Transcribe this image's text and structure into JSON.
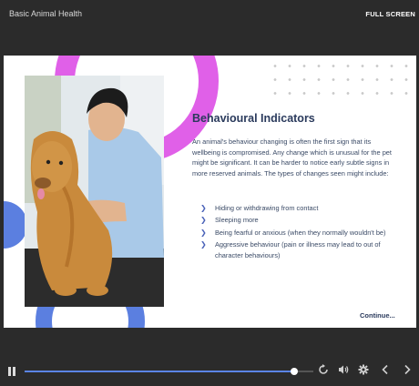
{
  "app": {
    "title": "Basic Animal Health",
    "fullscreen_label": "FULL SCREEN"
  },
  "slide": {
    "heading": "Behavioural Indicators",
    "body": "An animal's behaviour changing is often the first sign that its wellbeing is compromised.  Any change which is unusual for the pet might be significant. It can be harder to notice early subtle signs in more reserved animals. The types of changes seen might include:",
    "bullets": [
      "Hiding or withdrawing from contact",
      "Sleeping more",
      "Being fearful or anxious (when they normally wouldn't be)",
      "Aggressive behaviour (pain or illness may lead to out of character behaviours)"
    ],
    "continue_label": "Continue...",
    "colors": {
      "accent_pink": "#e060e8",
      "accent_blue": "#5b7fe0",
      "heading": "#2a3a5c"
    }
  },
  "player": {
    "progress": 0.935,
    "icons": [
      "pause-icon",
      "replay-icon",
      "volume-icon",
      "settings-icon",
      "previous-icon",
      "next-icon"
    ]
  }
}
